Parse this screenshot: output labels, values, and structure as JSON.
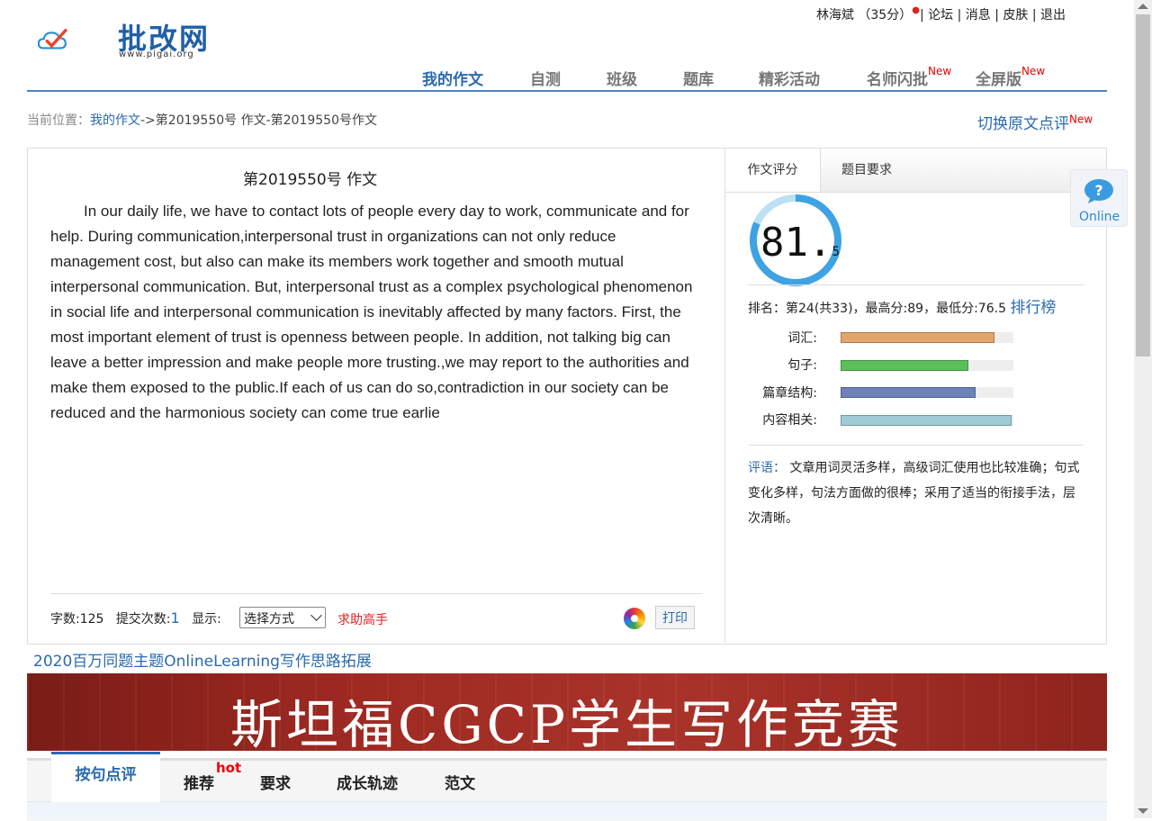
{
  "header": {
    "logo_text": "批改网",
    "logo_url": "www.pigai.org",
    "user": "林海斌",
    "points": "（35分）",
    "links": [
      "论坛",
      "消息",
      "皮肤",
      "退出"
    ]
  },
  "nav": [
    {
      "label": "我的作文",
      "active": true
    },
    {
      "label": "自测"
    },
    {
      "label": "班级"
    },
    {
      "label": "题库"
    },
    {
      "label": "精彩活动"
    },
    {
      "label": "名师闪批",
      "badge": "New"
    },
    {
      "label": "全屏版",
      "badge": "New"
    }
  ],
  "breadcrumb": {
    "prefix": "当前位置：",
    "link": "我的作文",
    "current": "->第2019550号 作文-第2019550号作文"
  },
  "switch_link": {
    "label": "切换原文点评",
    "badge": "New"
  },
  "essay": {
    "title": "第2019550号 作文",
    "body": "In our daily life, we have to contact lots of people every day to work, communicate and for help. During communication,interpersonal trust in organizations can not only reduce management cost, but also can make its members work together and smooth mutual interpersonal communication. But, interpersonal trust as a complex psychological phenomenon in social life and interpersonal communication is inevitably affected by many factors. First, the most important element of trust is openness between people. In addition, not talking big can leave a better impression and make people more trusting.,we may report to the authorities and make them exposed to the public.If each of us can do so,contradiction in our society can be reduced and the harmonious society can come true earlie",
    "word_count_label": "字数:125",
    "submit_label": "提交次数:",
    "submit_count": "1",
    "display_label": "显示:",
    "display_select": "选择方式",
    "help_label": "求助高手",
    "print_label": "打印"
  },
  "side": {
    "tabs": [
      "作文评分",
      "题目要求"
    ],
    "score_int": "81.",
    "score_dec": "5",
    "score_value": 81.5,
    "rank_text": "排名：第24(共33)，最高分:89，最低分:76.5",
    "rank_link": "排行榜",
    "bars": [
      {
        "label": "词汇:",
        "value": 0.89,
        "color": "#e2a56c"
      },
      {
        "label": "句子:",
        "value": 0.74,
        "color": "#5cbf5c"
      },
      {
        "label": "篇章结构:",
        "value": 0.78,
        "color": "#6c82b9"
      },
      {
        "label": "内容相关:",
        "value": 0.99,
        "color": "#9ecbd6"
      }
    ],
    "comment_label": "评语：",
    "comment": "文章用词灵活多样，高级词汇使用也比较准确；句式变化多样，句法方面做的很棒；采用了适当的衔接手法，层次清晰。"
  },
  "online": {
    "label": "Online"
  },
  "promo": {
    "link": "2020百万同题主题OnlineLearning写作思路拓展",
    "banner": "斯坦福CGCP学生写作竞赛"
  },
  "bottom_tabs": [
    {
      "label": "按句点评",
      "active": true
    },
    {
      "label": "推荐",
      "badge": "hot"
    },
    {
      "label": "要求"
    },
    {
      "label": "成长轨迹"
    },
    {
      "label": "范文"
    }
  ]
}
